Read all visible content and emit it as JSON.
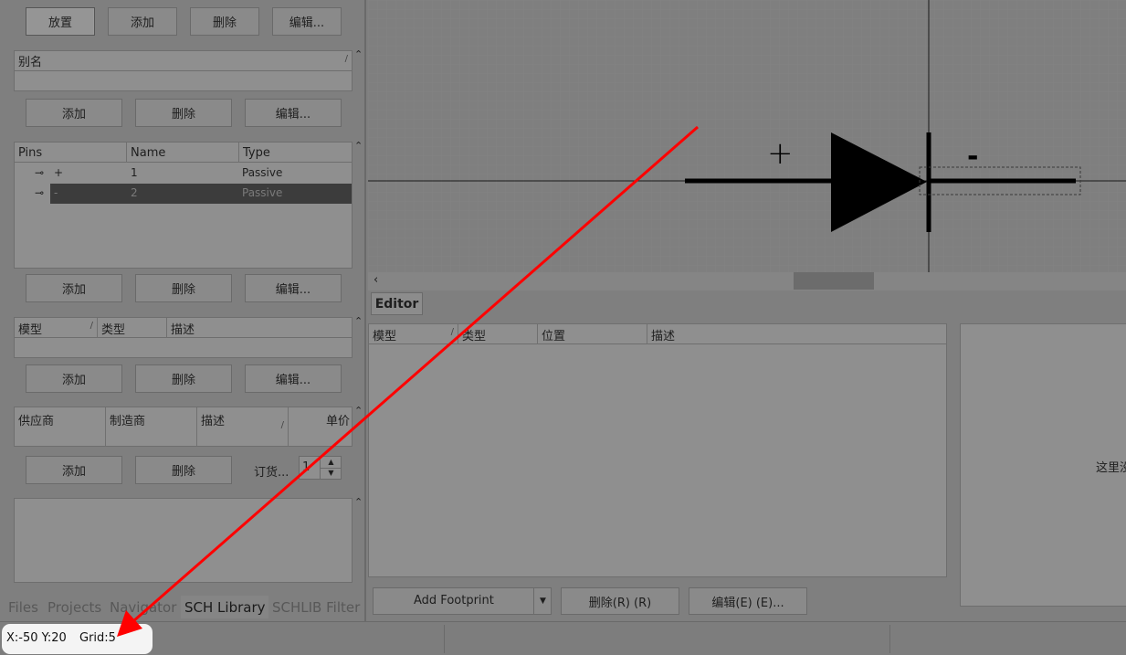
{
  "components_panel": {
    "place_label": "放置",
    "add_label": "添加",
    "delete_label": "删除",
    "edit_label": "编辑..."
  },
  "alias_panel": {
    "header": "别名",
    "add_label": "添加",
    "delete_label": "删除",
    "edit_label": "编辑..."
  },
  "pins_panel": {
    "columns": [
      "Pins",
      "Name",
      "Type"
    ],
    "rows": [
      {
        "pin": "+",
        "name": "1",
        "type": "Passive"
      },
      {
        "pin": "-",
        "name": "2",
        "type": "Passive"
      }
    ],
    "add_label": "添加",
    "delete_label": "删除",
    "edit_label": "编辑..."
  },
  "model_panel": {
    "columns": [
      "模型",
      "类型",
      "描述"
    ],
    "add_label": "添加",
    "delete_label": "删除",
    "edit_label": "编辑..."
  },
  "supplier_panel": {
    "columns": [
      "供应商",
      "制造商",
      "描述",
      "单价"
    ],
    "add_label": "添加",
    "delete_label": "删除",
    "order_label": "订货...",
    "quantity": "1"
  },
  "bottom_tabs": [
    "Files",
    "Projects",
    "Navigator",
    "SCH Library",
    "SCHLIB Filter"
  ],
  "canvas": {
    "plus_label": "+",
    "minus_label": "-"
  },
  "editor": {
    "title": "Editor",
    "columns": [
      "模型",
      "类型",
      "位置",
      "描述"
    ],
    "preview_text": "这里没",
    "add_footprint_label": "Add Footprint",
    "delete_label": "删除(R) (R)",
    "edit_label": "编辑(E) (E)..."
  },
  "status_bar": {
    "coords": "X:-50 Y:20",
    "grid": "Grid:5"
  },
  "colors": {
    "annotation_arrow": "#ff0000",
    "dim_background": "#7f7f7f"
  }
}
